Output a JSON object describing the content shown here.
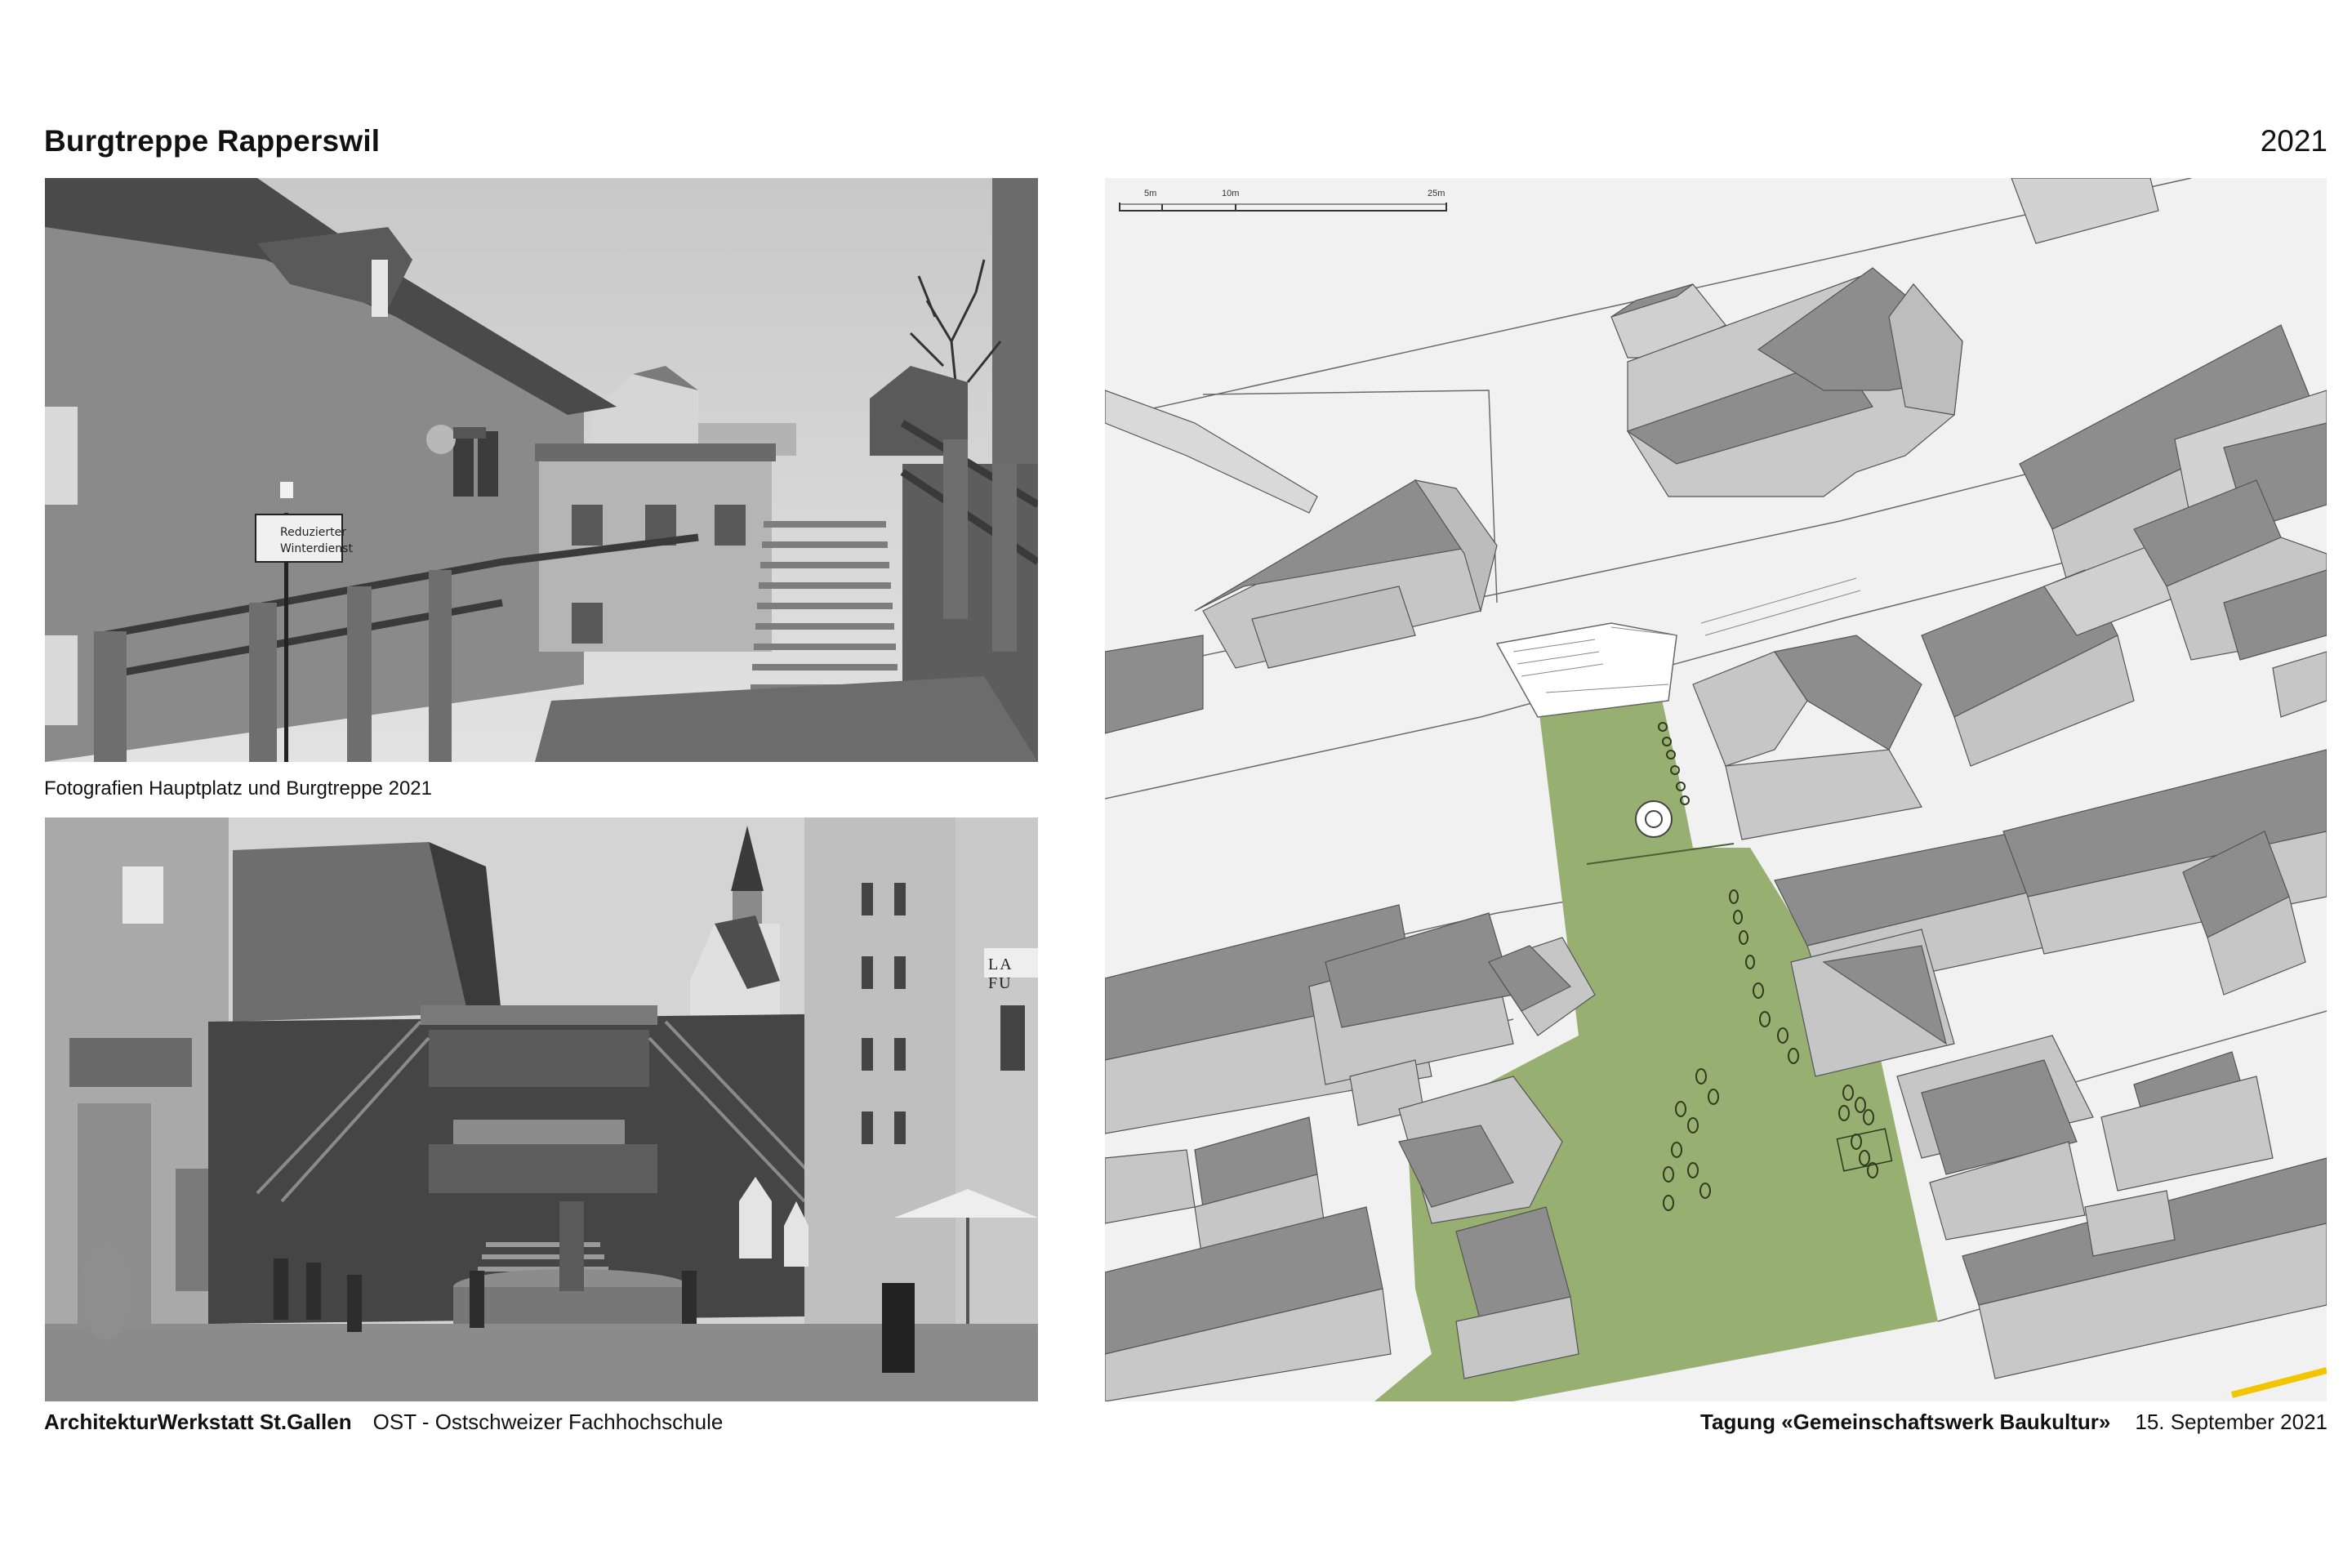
{
  "header": {
    "title": "Burgtreppe Rapperswil",
    "year": "2021"
  },
  "photos": {
    "caption": "Fotografien Hauptplatz und Burgtreppe 2021",
    "sign_line1": "Reduzierter",
    "sign_line2": "Winterdienst",
    "shop_sign": "LA FU"
  },
  "map": {
    "scale_labels": [
      "5m",
      "10m",
      "25m"
    ],
    "colors": {
      "square": "#97b072",
      "roof_dark": "#8d8d8d",
      "roof_light": "#c9c9c9",
      "ground": "#f1f1f1",
      "road_line": "#f2c500"
    }
  },
  "footer": {
    "org": "ArchitekturWerkstatt St.Gallen",
    "school": "OST - Ostschweizer Fachhochschule",
    "event": "Tagung «Gemeinschaftswerk Baukultur»",
    "date": "15. September 2021"
  }
}
